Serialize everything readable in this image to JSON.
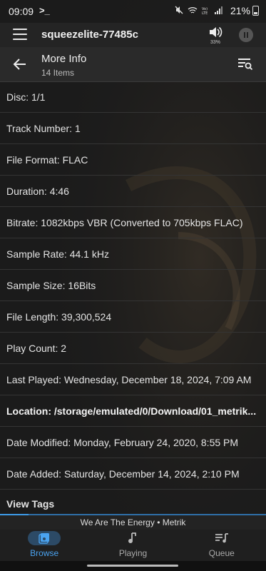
{
  "status_bar": {
    "time": "09:09",
    "prompt_icon": ">_",
    "battery_text": "21%",
    "icons": [
      "mute-icon",
      "wifi-icon",
      "volte-icon",
      "signal-icon",
      "battery-icon"
    ]
  },
  "app_bar": {
    "player_name": "squeezelite-77485c",
    "volume_percent": "33%"
  },
  "sub_header": {
    "title": "More Info",
    "count": "14 Items"
  },
  "info_rows": [
    "Disc: 1/1",
    "Track Number: 1",
    "File Format: FLAC",
    "Duration: 4:46",
    "Bitrate: 1082kbps VBR (Converted to 705kbps FLAC)",
    "Sample Rate: 44.1 kHz",
    "Sample Size: 16Bits",
    "File Length: 39,300,524",
    "Play Count: 2",
    "Last Played: Wednesday, December 18, 2024, 7:09 AM",
    "Location: /storage/emulated/0/Download/01_metrik...",
    "Date Modified: Monday, February 24, 2020, 8:55 PM",
    "Date Added: Saturday, December 14, 2024, 2:10 PM",
    "View Tags"
  ],
  "now_playing": {
    "text": "We Are The Energy • Metrik"
  },
  "bottom_nav": {
    "browse": "Browse",
    "playing": "Playing",
    "queue": "Queue"
  },
  "colors": {
    "accent": "#4aa3f0",
    "background": "#1b1b1b"
  }
}
